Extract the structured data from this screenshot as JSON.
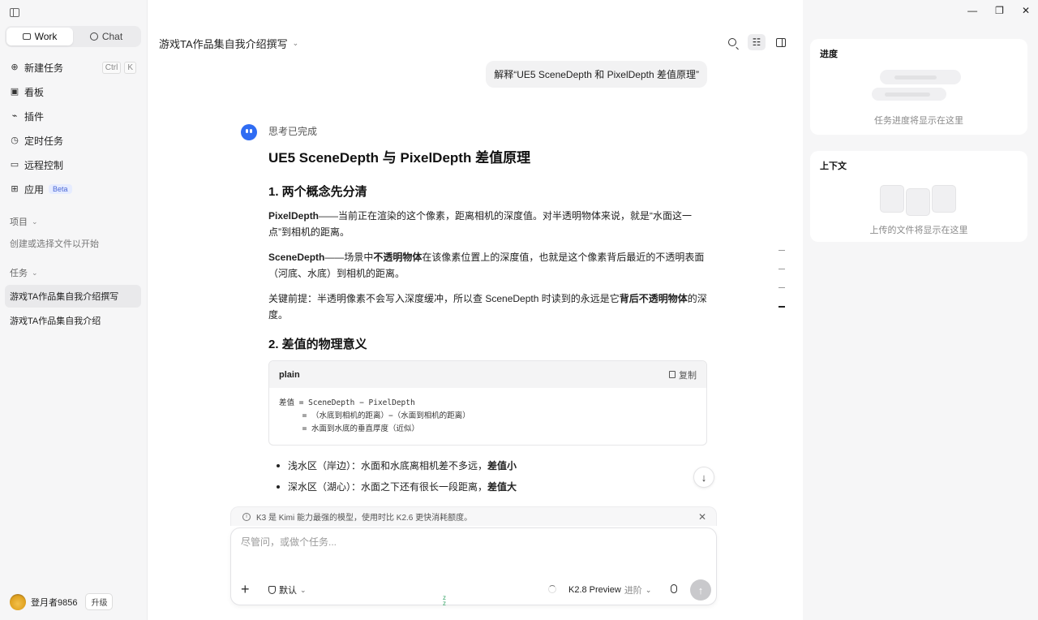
{
  "sidebar": {
    "modes": [
      {
        "label": "Work",
        "active": true
      },
      {
        "label": "Chat",
        "active": false
      }
    ],
    "nav": [
      {
        "label": "新建任务",
        "icon": "plus-circle-icon",
        "shortcut": [
          "Ctrl",
          "K"
        ]
      },
      {
        "label": "看板",
        "icon": "board-icon"
      },
      {
        "label": "插件",
        "icon": "plug-icon"
      },
      {
        "label": "定时任务",
        "icon": "clock-icon"
      },
      {
        "label": "远程控制",
        "icon": "monitor-icon"
      },
      {
        "label": "应用",
        "icon": "apps-icon",
        "badge": "Beta"
      }
    ],
    "projects_label": "项目",
    "projects_hint": "创建或选择文件以开始",
    "tasks_label": "任务",
    "tasks": [
      {
        "label": "游戏TA作品集自我介绍撰写",
        "active": true
      },
      {
        "label": "游戏TA作品集自我介绍",
        "active": false
      }
    ],
    "user": {
      "name": "登月者9856",
      "upgrade_label": "升级"
    }
  },
  "main": {
    "title": "游戏TA作品集自我介绍撰写",
    "user_message": "解释“UE5 SceneDepth 和 PixelDepth 差值原理”",
    "thinking_label": "思考已完成",
    "heading": "UE5 SceneDepth 与 PixelDepth 差值原理",
    "section1_title": "1. 两个概念先分清",
    "p1_term": "PixelDepth",
    "p1_text": "——当前正在渲染的这个像素，距离相机的深度值。对半透明物体来说，就是“水面这一点”到相机的距离。",
    "p2_term": "SceneDepth",
    "p2_a": "——场景中",
    "p2_bold": "不透明物体",
    "p2_b": "在该像素位置上的深度值，也就是这个像素背后最近的不透明表面（河底、水底）到相机的距离。",
    "p3_a": "关键前提：半透明像素不会写入深度缓冲，所以查 SceneDepth 时读到的永远是它",
    "p3_bold": "背后不透明物体",
    "p3_b": "的深度。",
    "section2_title": "2. 差值的物理意义",
    "code": {
      "lang": "plain",
      "copy_label": "复制",
      "lines": [
        "差值 = SceneDepth − PixelDepth",
        "     = （水底到相机的距离）−（水面到相机的距离）",
        "     = 水面到水底的垂直厚度（近似）"
      ]
    },
    "bullets": [
      {
        "text": "浅水区（岸边）：水面和水底离相机差不多远，",
        "bold": "差值小"
      },
      {
        "text": "深水区（湖心）：水面之下还有很长一段距离，",
        "bold": "差值大"
      }
    ]
  },
  "composer": {
    "notice": "K3 是 Kimi 能力最强的模型，使用时比 K2.6 更快消耗额度。",
    "placeholder": "尽管问，或做个任务...",
    "mode_label": "默认",
    "model_name": "K2.8 Preview",
    "model_tier": "进阶"
  },
  "right_panel": {
    "progress_title": "进度",
    "progress_empty": "任务进度将显示在这里",
    "context_title": "上下文",
    "context_empty": "上传的文件将显示在这里"
  },
  "window_controls": [
    "minimize-icon",
    "restore-icon",
    "close-icon"
  ]
}
